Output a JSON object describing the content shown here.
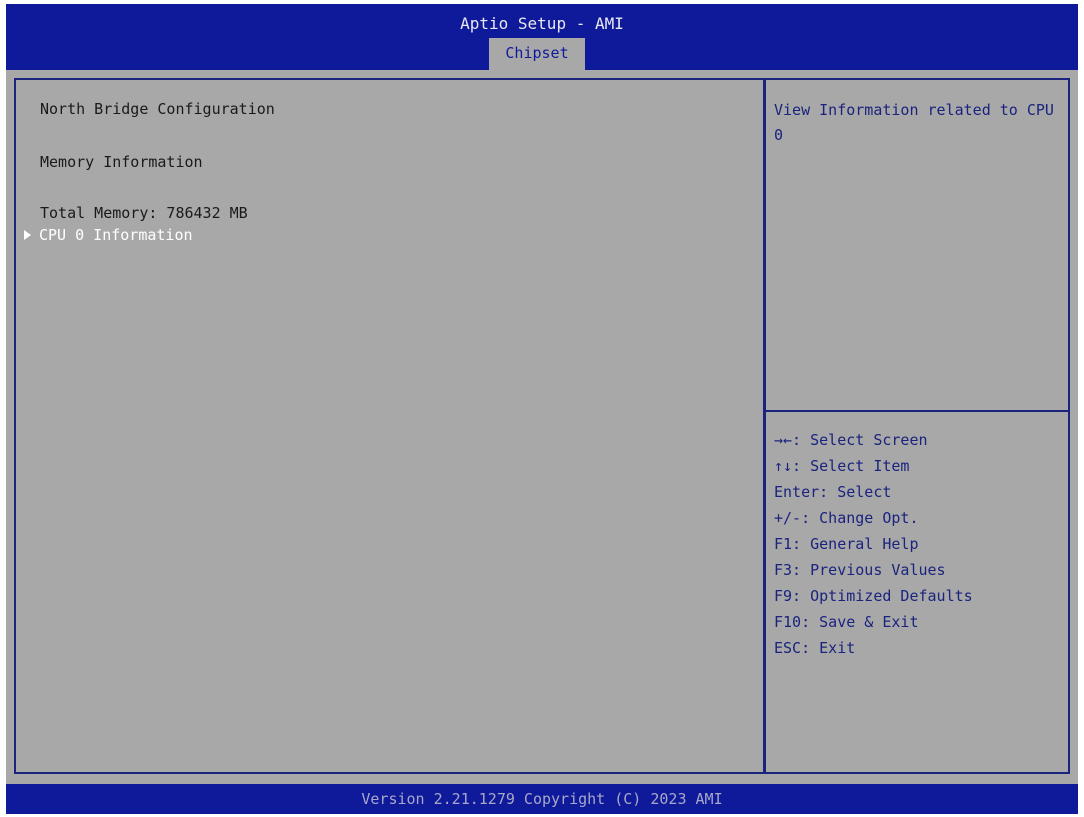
{
  "header": {
    "title": "Aptio Setup - AMI",
    "active_tab": "Chipset"
  },
  "main": {
    "section_title": "North Bridge Configuration",
    "memory_heading": "Memory Information",
    "total_memory": "Total Memory: 786432 MB",
    "selected_item": "CPU 0 Information"
  },
  "help": {
    "text": "View Information related to CPU 0"
  },
  "keys": [
    "→←: Select Screen",
    "↑↓: Select Item",
    "Enter: Select",
    "+/-: Change Opt.",
    "F1: General Help",
    "F3: Previous Values",
    "F9: Optimized Defaults",
    "F10: Save & Exit",
    "ESC: Exit"
  ],
  "footer": {
    "text": "Version 2.21.1279 Copyright (C) 2023 AMI"
  },
  "colors": {
    "header_blue": "#0f1a9a",
    "panel_gray": "#a8a8a8",
    "help_text_blue": "#1a237e",
    "selected_white": "#ffffff"
  },
  "icons": {
    "selection_marker": "right-triangle-icon"
  }
}
